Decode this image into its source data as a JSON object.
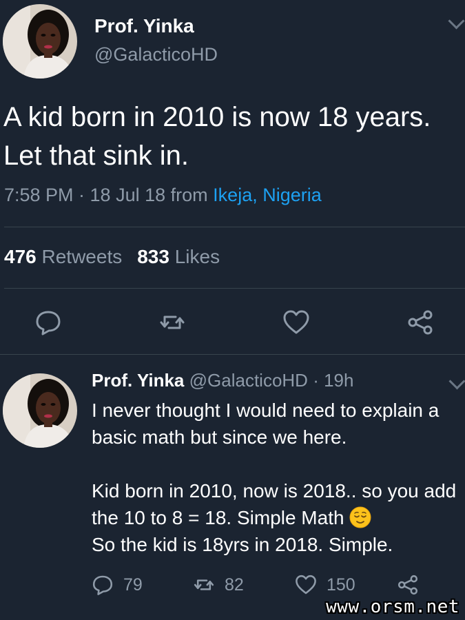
{
  "tweet": {
    "author_name": "Prof. Yinka",
    "author_handle": "@GalacticoHD",
    "text": "A kid born in 2010 is now 18 years. Let that sink in.",
    "time": "7:58 PM · 18 Jul 18",
    "from_label": "from",
    "location": "Ikeja, Nigeria",
    "retweets_count": "476",
    "retweets_label": "Retweets",
    "likes_count": "833",
    "likes_label": "Likes",
    "actions": [
      "reply-icon",
      "retweet-icon",
      "like-icon",
      "share-icon"
    ],
    "menu_icon": "chevron-down-icon"
  },
  "reply": {
    "author_name": "Prof. Yinka",
    "author_handle": "@GalacticoHD",
    "age": "· 19h",
    "paragraph1": "I never thought I would need to explain a basic math but since we here.",
    "paragraph2_line1": "Kid born in 2010, now is 2018.. so you add the 10 to 8 = 18. Simple Math",
    "emoji": "relieved-face-emoji",
    "paragraph2_line2": "So the kid is 18yrs in 2018. Simple.",
    "reply_count": "79",
    "retweet_count": "82",
    "like_count": "150",
    "menu_icon": "chevron-down-icon"
  },
  "watermark": "www.orsm.net",
  "colors": {
    "background": "#1b2431",
    "text": "#ffffff",
    "secondary_text": "#8f9ba9",
    "link": "#1da1f2",
    "divider": "#38444d"
  }
}
